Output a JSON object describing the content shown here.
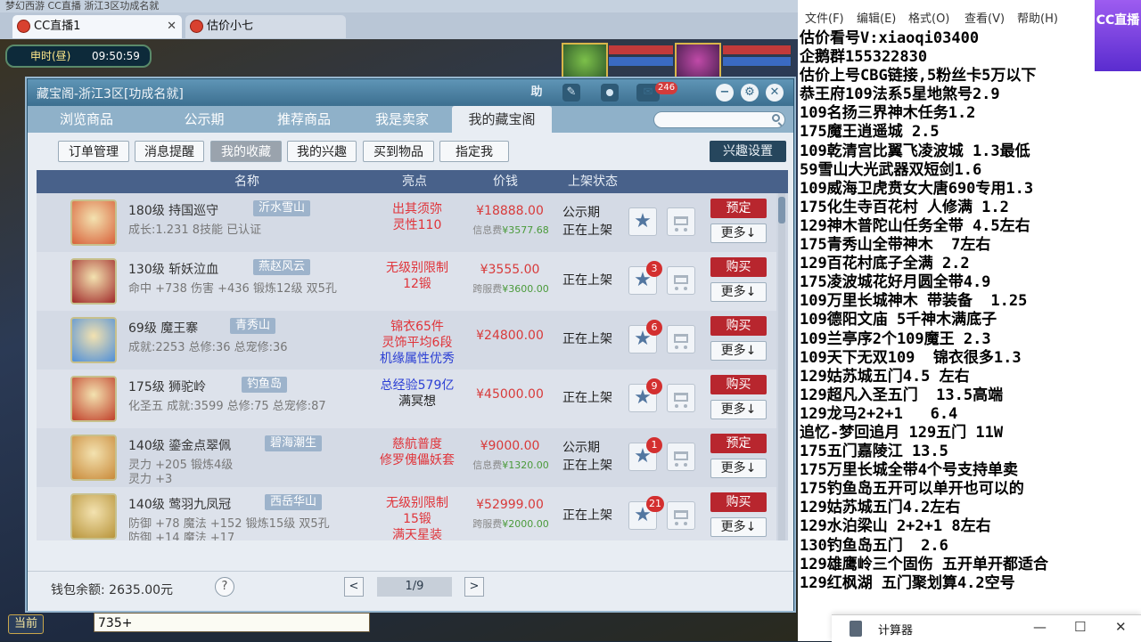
{
  "browser": {
    "top_text": "梦幻西游  CC直播  浙江3区功成名就",
    "tabs": [
      {
        "label": "CC直播1"
      },
      {
        "label": "估价小七"
      }
    ]
  },
  "game": {
    "clock_label": "申时(昼)",
    "clock_time": "09:50:59",
    "chat_current": "当前",
    "chat_input": "735+"
  },
  "window": {
    "title": "藏宝阁-浙江3区[功成名就]",
    "help_label": "助",
    "message_count": "246",
    "main_tabs": [
      "浏览商品",
      "公示期",
      "推荐商品",
      "我是卖家",
      "我的藏宝阁"
    ],
    "sub_tabs": [
      "订单管理",
      "消息提醒",
      "我的收藏",
      "我的兴趣",
      "买到物品",
      "指定我"
    ],
    "interest_setting": "兴趣设置",
    "columns": {
      "name": "名称",
      "highlight": "亮点",
      "price": "价钱",
      "status": "上架状态"
    },
    "rows": [
      {
        "title": "180级  持国巡守",
        "server": "沂水雪山",
        "attrs": [
          "成长:1.231  8技能  已认证"
        ],
        "highlights": [
          {
            "text": "出其须弥",
            "color": "#e0343a"
          },
          {
            "text": "灵性110",
            "color": "#e0343a"
          }
        ],
        "price": "¥18888.00",
        "fee_label": "信息费",
        "fee": "¥3577.68",
        "status": [
          "公示期",
          "正在上架"
        ],
        "badge": "",
        "action": "预定",
        "more": "更多↓",
        "icon_bg": "#d8613a"
      },
      {
        "title": "130级  斩妖泣血",
        "server": "燕赵风云",
        "attrs": [
          "命中 +738  伤害 +436  锻炼12级  双5孔"
        ],
        "highlights": [
          {
            "text": "无级别限制",
            "color": "#e0343a"
          },
          {
            "text": "12锻",
            "color": "#e0343a"
          }
        ],
        "price": "¥3555.00",
        "fee_label": "跨服费",
        "fee": "¥3600.00",
        "status": [
          "正在上架"
        ],
        "badge": "3",
        "action": "购买",
        "more": "更多↓",
        "icon_bg": "#a02a2a"
      },
      {
        "title": "69级  魔王寨",
        "server": "青秀山",
        "attrs": [
          "成就:2253  总修:36  总宠修:36"
        ],
        "highlights": [
          {
            "text": "锦衣65件",
            "color": "#e0343a"
          },
          {
            "text": "灵饰平均6段",
            "color": "#e0343a"
          },
          {
            "text": "机缘属性优秀",
            "color": "#2b3fd4"
          }
        ],
        "price": "¥24800.00",
        "fee_label": "",
        "fee": "",
        "status": [
          "正在上架"
        ],
        "badge": "6",
        "action": "购买",
        "more": "更多↓",
        "icon_bg": "#4f8fd8"
      },
      {
        "title": "175级  狮驼岭",
        "server": "钓鱼岛",
        "attrs": [
          "化圣五  成就:3599  总修:75  总宠修:87"
        ],
        "highlights": [
          {
            "text": "总经验579亿",
            "color": "#2b3fd4"
          },
          {
            "text": "满冥想",
            "color": "#222222"
          }
        ],
        "price": "¥45000.00",
        "fee_label": "",
        "fee": "",
        "status": [
          "正在上架"
        ],
        "badge": "9",
        "action": "购买",
        "more": "更多↓",
        "icon_bg": "#c0402a"
      },
      {
        "title": "140级  鎏金点翠佩",
        "server": "碧海潮生",
        "attrs": [
          "灵力 +205  锻炼4级",
          "灵力 +3"
        ],
        "highlights": [
          {
            "text": "慈航普度",
            "color": "#e0343a"
          },
          {
            "text": "修罗傀儡妖套",
            "color": "#e0343a"
          }
        ],
        "price": "¥9000.00",
        "fee_label": "信息费",
        "fee": "¥1320.00",
        "status": [
          "公示期",
          "正在上架"
        ],
        "badge": "1",
        "action": "预定",
        "more": "更多↓",
        "icon_bg": "#c98a3a"
      },
      {
        "title": "140级  莺羽九凤冠",
        "server": "西岳华山",
        "attrs": [
          "防御 +78  魔法 +152  锻炼15级  双5孔",
          "防御 +14  魔法 +17"
        ],
        "highlights": [
          {
            "text": "无级别限制",
            "color": "#e0343a"
          },
          {
            "text": "15锻",
            "color": "#e0343a"
          },
          {
            "text": "满天星装",
            "color": "#e0343a"
          }
        ],
        "price": "¥52999.00",
        "fee_label": "跨服费",
        "fee": "¥2000.00",
        "status": [
          "正在上架"
        ],
        "badge": "21",
        "action": "购买",
        "more": "更多↓",
        "icon_bg": "#b8943a"
      }
    ],
    "footer": {
      "wallet": "钱包余额: 2635.00元",
      "help": "?",
      "page": "1/9",
      "prev": "<",
      "next": ">"
    }
  },
  "notepad": {
    "menu": [
      "文件(F)",
      "编辑(E)",
      "格式(O)",
      "查看(V)",
      "帮助(H)"
    ],
    "lines": [
      "估价看号V:xiaoqi03400",
      "企鹅群155322830",
      "估价上号CBG链接,5粉丝卡5万以下",
      "恭王府109法系5星地煞号2.9",
      "109名扬三界神木任务1.2",
      "175魔王逍遥城 2.5",
      "109乾清宫比翼飞凌波城 1.3最低",
      "59雪山大光武器双短剑1.6",
      "109威海卫虎贲女大唐690专用1.3",
      "175化生寺百花村 人修满 1.2",
      "129神木普陀山任务全带 4.5左右",
      "175青秀山全带神木  7左右",
      "129百花村底子全满 2.2",
      "175凌波城花好月圆全带4.9",
      "109万里长城神木 带装备  1.25",
      "109德阳文庙 5千神木满底子",
      "109兰亭序2个109魔王 2.3",
      "109天下无双109  锦衣很多1.3",
      "129姑苏城五门4.5 左右",
      "129超凡入圣五门  13.5高端",
      "129龙马2+2+1   6.4",
      "追忆-梦回追月 129五门 11W",
      "175五门嘉陵江 13.5",
      "175万里长城全带4个号支持单卖",
      "175钓鱼岛五开可以单开也可以的",
      "129姑苏城五门4.2左右",
      "129水泊梁山 2+2+1 8左右",
      "130钓鱼岛五门  2.6",
      "129雄鹰岭三个固伤 五开单开都适合",
      "129红枫湖 五门聚划算4.2空号"
    ]
  },
  "calculator": {
    "title": "计算器"
  },
  "cc_logo": "CC直播"
}
